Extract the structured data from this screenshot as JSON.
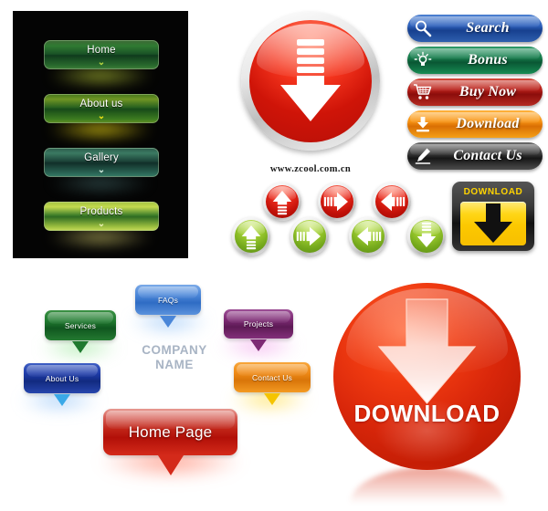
{
  "dark_menu": {
    "items": [
      {
        "label": "Home",
        "chevron": "⌄",
        "color": "#2f7a32"
      },
      {
        "label": "About us",
        "chevron": "⌄",
        "color": "#6f9524"
      },
      {
        "label": "Gallery",
        "chevron": "⌄",
        "color": "#3b7a62"
      },
      {
        "label": "Products",
        "chevron": "⌄",
        "color": "#c3d94f"
      }
    ]
  },
  "red_circle": {
    "icon": "download-striped-arrow-icon",
    "color": "#e8281a"
  },
  "watermark": {
    "url": "www.zcool.com.cn"
  },
  "arrow_buttons": {
    "red": [
      {
        "direction": "up",
        "color": "#e8281a"
      },
      {
        "direction": "right",
        "color": "#e8281a"
      },
      {
        "direction": "left",
        "color": "#e8281a"
      }
    ],
    "green": [
      {
        "direction": "up",
        "color": "#9ccb2e"
      },
      {
        "direction": "right",
        "color": "#9ccb2e"
      },
      {
        "direction": "left",
        "color": "#9ccb2e"
      },
      {
        "direction": "down",
        "color": "#9ccb2e"
      }
    ]
  },
  "download_square": {
    "label": "DOWNLOAD",
    "accent": "#ffd617",
    "frame": "#111111"
  },
  "pills": [
    {
      "label": "Search",
      "icon": "magnifier-icon",
      "color": "#2f62bd"
    },
    {
      "label": "Bonus",
      "icon": "lightbulb-icon",
      "color": "#177d4d"
    },
    {
      "label": "Buy Now",
      "icon": "cart-icon",
      "color": "#b9201a"
    },
    {
      "label": "Download",
      "icon": "download-icon",
      "color": "#f79312"
    },
    {
      "label": "Contact Us",
      "icon": "pen-icon",
      "color": "#3d3d3d"
    }
  ],
  "bubbles": {
    "faqs": {
      "label": "FAQs",
      "color": "#4a86d8"
    },
    "services": {
      "label": "Services",
      "color": "#1f7a2f"
    },
    "projects": {
      "label": "Projects",
      "color": "#7d2a74"
    },
    "about_us": {
      "label": "About Us",
      "color": "#1e3ba8"
    },
    "contact_us": {
      "label": "Contact Us",
      "color": "#ef8a17"
    },
    "home_page": {
      "label": "Home Page",
      "color": "#c02418"
    },
    "company": {
      "line1": "COMPANY",
      "line2": "NAME",
      "color": "#a8b4c4"
    }
  },
  "download_sphere": {
    "label": "DOWNLOAD",
    "icon": "down-arrow-icon",
    "color": "#d8260a"
  }
}
